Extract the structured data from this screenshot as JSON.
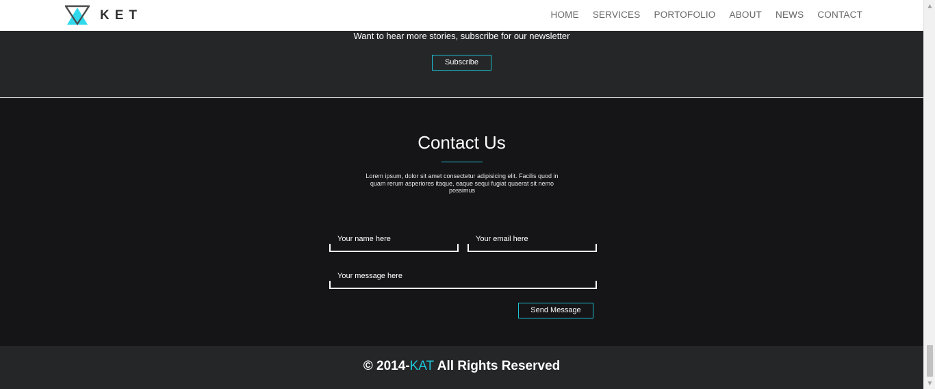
{
  "header": {
    "brand": "KET",
    "nav": [
      "HOME",
      "SERVICES",
      "PORTOFOLIO",
      "ABOUT",
      "NEWS",
      "CONTACT"
    ]
  },
  "newsletter": {
    "text": "Want to hear more stories, subscribe for our newsletter",
    "button": "Subscribe"
  },
  "contact": {
    "title": "Contact Us",
    "description": "Lorem ipsum, dolor sit amet consectetur adipisicing elit. Facilis quod in quam rerum asperiores itaque, eaque sequi fugiat quaerat sit nemo possimus",
    "name_placeholder": "Your name here",
    "email_placeholder": "Your email here",
    "message_placeholder": "Your message here",
    "send_button": "Send Message"
  },
  "footer": {
    "prefix": "© 2014-",
    "brand": "KAT",
    "suffix": " All Rights Reserved"
  },
  "colors": {
    "accent": "#1ec3d8",
    "dark_band": "#242627",
    "contact_bg": "#151517",
    "header_bg": "#ffffff"
  },
  "icons": {
    "logo": "ket-triangle-logo-icon",
    "scroll_up": "scroll-up-arrow-icon",
    "scroll_down": "scroll-down-arrow-icon"
  }
}
